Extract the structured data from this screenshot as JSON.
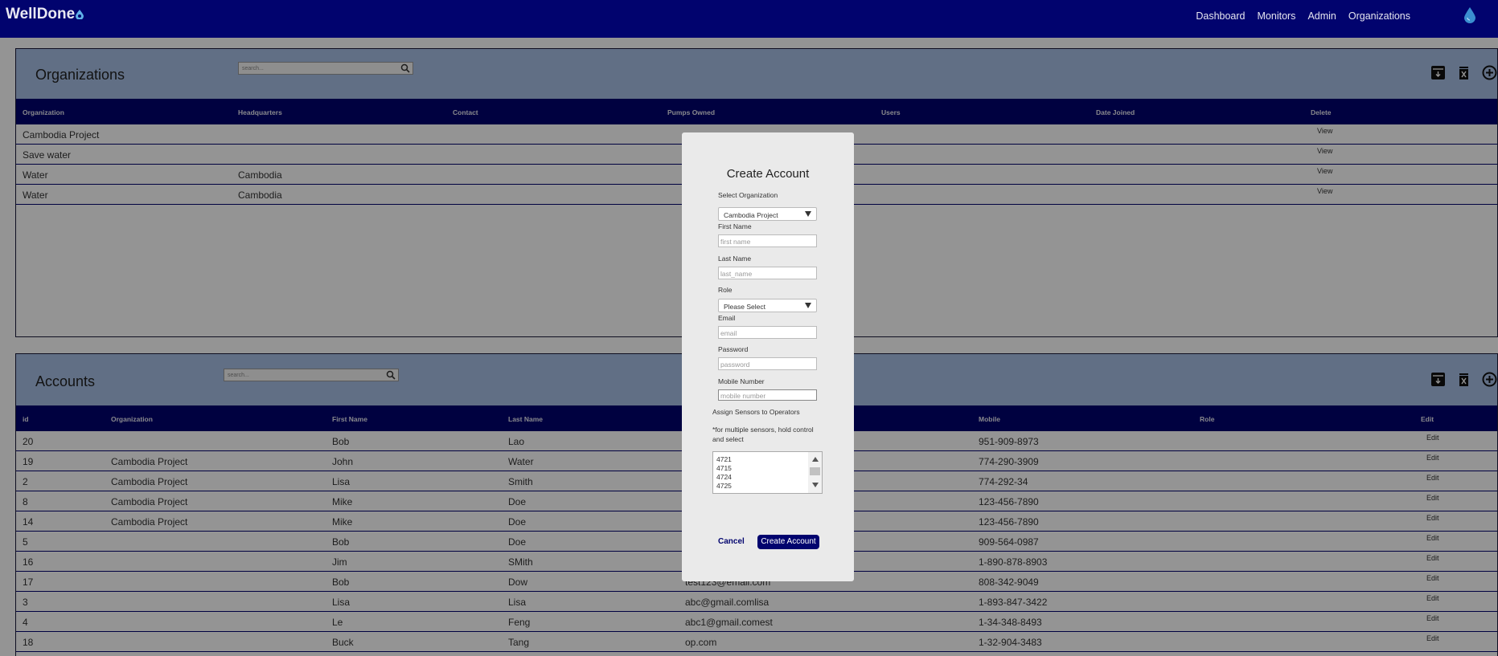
{
  "nav": {
    "brand": "WellDone",
    "links": [
      "Dashboard",
      "Monitors",
      "Admin",
      "Organizations"
    ]
  },
  "organizations": {
    "title": "Organizations",
    "search_placeholder": "search...",
    "columns": [
      "Organization",
      "Headquarters",
      "Contact",
      "Pumps Owned",
      "Users",
      "Date Joined",
      "Delete"
    ],
    "rows": [
      {
        "organization": "Cambodia Project",
        "headquarters": "",
        "action": "View"
      },
      {
        "organization": "Save water",
        "headquarters": "",
        "action": "View"
      },
      {
        "organization": "Water",
        "headquarters": "Cambodia",
        "action": "View"
      },
      {
        "organization": "Water",
        "headquarters": "Cambodia",
        "action": "View"
      }
    ]
  },
  "accounts": {
    "title": "Accounts",
    "search_placeholder": "search...",
    "columns": [
      "id",
      "Organization",
      "First Name",
      "Last Name",
      "",
      "Mobile",
      "Role",
      "Edit"
    ],
    "rows": [
      {
        "id": "20",
        "organization": "",
        "first": "Bob",
        "last": "Lao",
        "email": "",
        "mobile": "951-909-8973",
        "action": "Edit"
      },
      {
        "id": "19",
        "organization": "Cambodia Project",
        "first": "John",
        "last": "Water",
        "email": "",
        "mobile": "774-290-3909",
        "action": "Edit"
      },
      {
        "id": "2",
        "organization": "Cambodia Project",
        "first": "Lisa",
        "last": "Smith",
        "email": "",
        "mobile": "774-292-34",
        "action": "Edit"
      },
      {
        "id": "8",
        "organization": "Cambodia Project",
        "first": "Mike",
        "last": "Doe",
        "email": "",
        "mobile": "123-456-7890",
        "action": "Edit"
      },
      {
        "id": "14",
        "organization": "Cambodia Project",
        "first": "Mike",
        "last": "Doe",
        "email": "",
        "mobile": "123-456-7890",
        "action": "Edit"
      },
      {
        "id": "5",
        "organization": "",
        "first": "Bob",
        "last": "Doe",
        "email": "",
        "mobile": "909-564-0987",
        "action": "Edit"
      },
      {
        "id": "16",
        "organization": "",
        "first": "Jim",
        "last": "SMith",
        "email": "",
        "mobile": "1-890-878-8903",
        "action": "Edit"
      },
      {
        "id": "17",
        "organization": "",
        "first": "Bob",
        "last": "Dow",
        "email": "test123@email.com",
        "mobile": "808-342-9049",
        "action": "Edit"
      },
      {
        "id": "3",
        "organization": "",
        "first": "Lisa",
        "last": "Lisa",
        "email": "abc@gmail.comlisa",
        "mobile": "1-893-847-3422",
        "action": "Edit"
      },
      {
        "id": "4",
        "organization": "",
        "first": "Le",
        "last": "Feng",
        "email": "abc1@gmail.comest",
        "mobile": "1-34-348-8493",
        "action": "Edit"
      },
      {
        "id": "18",
        "organization": "",
        "first": "Buck",
        "last": "Tang",
        "email": "op.com",
        "mobile": "1-32-904-3483",
        "action": "Edit"
      }
    ]
  },
  "modal": {
    "title": "Create Account",
    "select_org_label": "Select Organization",
    "select_org_value": "Cambodia Project",
    "first_name_label": "First Name",
    "first_name_placeholder": "first name",
    "last_name_label": "Last Name",
    "last_name_placeholder": "last_name",
    "role_label": "Role",
    "role_value": "Please Select",
    "email_label": "Email",
    "email_placeholder": "email",
    "password_label": "Password",
    "password_placeholder": "password",
    "mobile_label": "Mobile Number",
    "mobile_placeholder": "mobile number",
    "sensors_label": "Assign Sensors to Operators",
    "sensors_hint": "*for multiple sensors, hold control and select",
    "sensor_options": [
      "4721",
      "4715",
      "4724",
      "4725"
    ],
    "cancel": "Cancel",
    "create": "Create Account"
  },
  "colors": {
    "navy": "#01036e",
    "panel_header": "#a8c0e6",
    "modal_bg": "#eaeaea"
  }
}
